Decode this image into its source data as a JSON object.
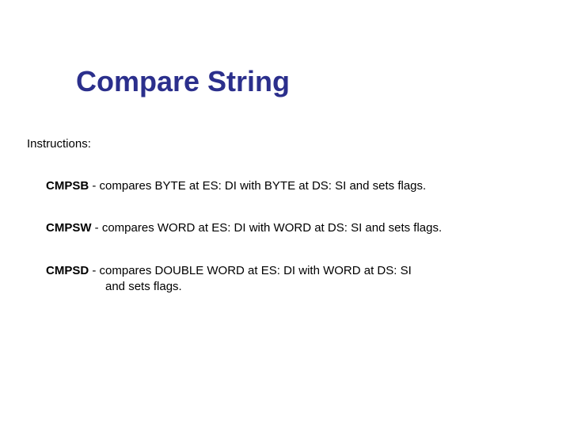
{
  "title": "Compare String",
  "section_label": "Instructions:",
  "items": [
    {
      "mnemonic": "CMPSB",
      "sep": " - ",
      "desc": "compares BYTE at ES: DI with BYTE at DS: SI and sets flags."
    },
    {
      "mnemonic": "CMPSW",
      "sep": " - ",
      "desc": "compares WORD at ES: DI with WORD at DS: SI and sets flags."
    },
    {
      "mnemonic": "CMPSD",
      "sep": " - ",
      "desc": "compares DOUBLE WORD at ES: DI with WORD at DS: SI",
      "desc2": "and sets flags."
    }
  ]
}
